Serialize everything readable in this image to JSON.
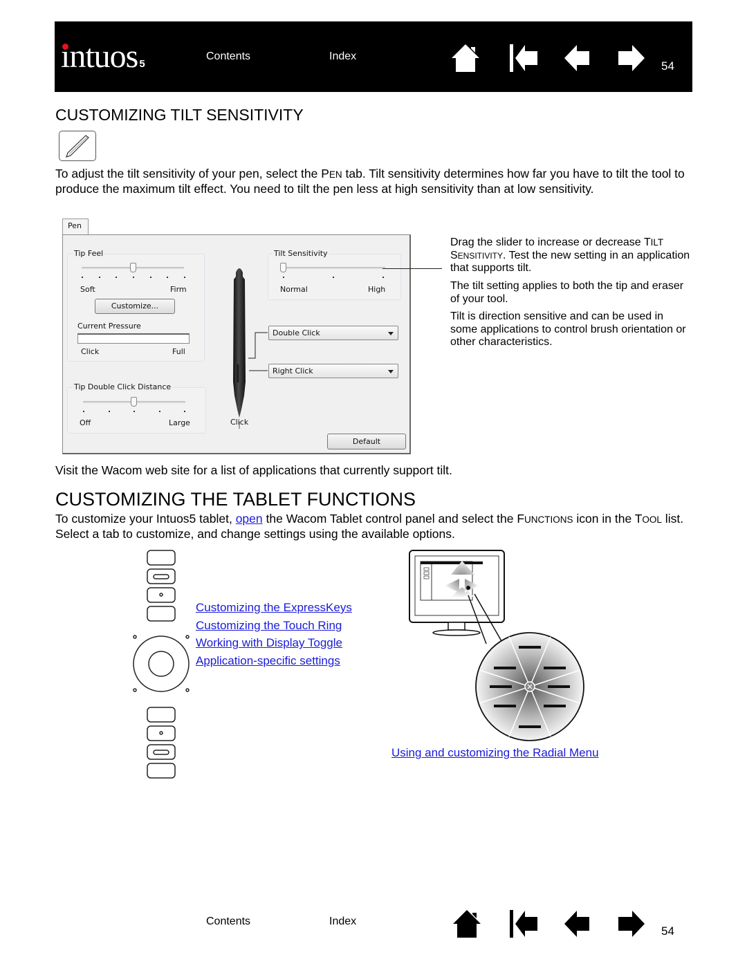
{
  "header": {
    "logo_text": "intuos",
    "logo_suffix": "5",
    "nav_links": {
      "contents": "Contents",
      "index": "Index"
    },
    "nav_icons": [
      "home-icon",
      "first-page-icon",
      "previous-page-icon",
      "next-page-icon"
    ],
    "page_number": "54"
  },
  "section_tilt": {
    "title": "CUSTOMIZING TILT SENSITIVITY",
    "tool_icon": "pen-icon",
    "intro_parts": {
      "a": "To adjust the tilt sensitivity of your pen, select the P",
      "a_sc": "EN",
      "b": " tab.  Tilt sensitivity determines how far you have to tilt the tool to produce the maximum tilt effect.  You need to tilt the pen less at high sensitivity than at low sensitivity."
    },
    "dialog": {
      "tab_label": "Pen",
      "tip_feel": {
        "label": "Tip Feel",
        "min_label": "Soft",
        "max_label": "Firm",
        "ticks": 7,
        "value_fraction": 0.5,
        "customize_button": "Customize...",
        "current_pressure_label": "Current Pressure",
        "pressure_min": "Click",
        "pressure_max": "Full",
        "pressure_fraction": 0
      },
      "tilt_sensitivity": {
        "label": "Tilt Sensitivity",
        "min_label": "Normal",
        "max_label": "High",
        "ticks": 3,
        "value_fraction": 0
      },
      "tip_double_click": {
        "label": "Tip Double Click Distance",
        "min_label": "Off",
        "max_label": "Large",
        "ticks": 5,
        "value_fraction": 0.5
      },
      "upper_button_select": "Double Click",
      "lower_button_select": "Right Click",
      "tip_label": "Click",
      "default_button": "Default"
    },
    "callouts": [
      {
        "a": "Drag the slider to increase or decrease T",
        "a_sc": "ILT",
        "b": "",
        "b_sc": "S",
        "c_sc": "ENSITIVITY",
        "c": ".  Test the new setting in an application that supports tilt."
      },
      {
        "text": "The tilt setting applies to both the tip and eraser of your tool."
      },
      {
        "text": "Tilt is direction sensitive and can be used in some applications to control brush orientation or other characteristics."
      }
    ],
    "footer_note": "Visit the Wacom web site for a list of applications that currently support tilt."
  },
  "section_functions": {
    "title": "CUSTOMIZING THE TABLET FUNCTIONS",
    "intro": {
      "a": "To customize your Intuos5 tablet, ",
      "link": "open",
      "b": " the Wacom Tablet control panel and select the F",
      "b_sc": "UNCTIONS",
      "c": " icon in the T",
      "c_sc": "OOL",
      "d": " list.  Select a tab to customize, and change settings using the available options."
    },
    "links": [
      "Customizing the ExpressKeys",
      "Customizing the Touch Ring",
      "Working with Display Toggle",
      "Application-specific settings"
    ],
    "radial_link": "Using and customizing the Radial Menu"
  },
  "footer": {
    "nav_links": {
      "contents": "Contents",
      "index": "Index"
    },
    "page_number": "54"
  },
  "colors": {
    "link": "#1a1adb",
    "header_bg": "#000000",
    "logo_dot": "#e3141b"
  }
}
